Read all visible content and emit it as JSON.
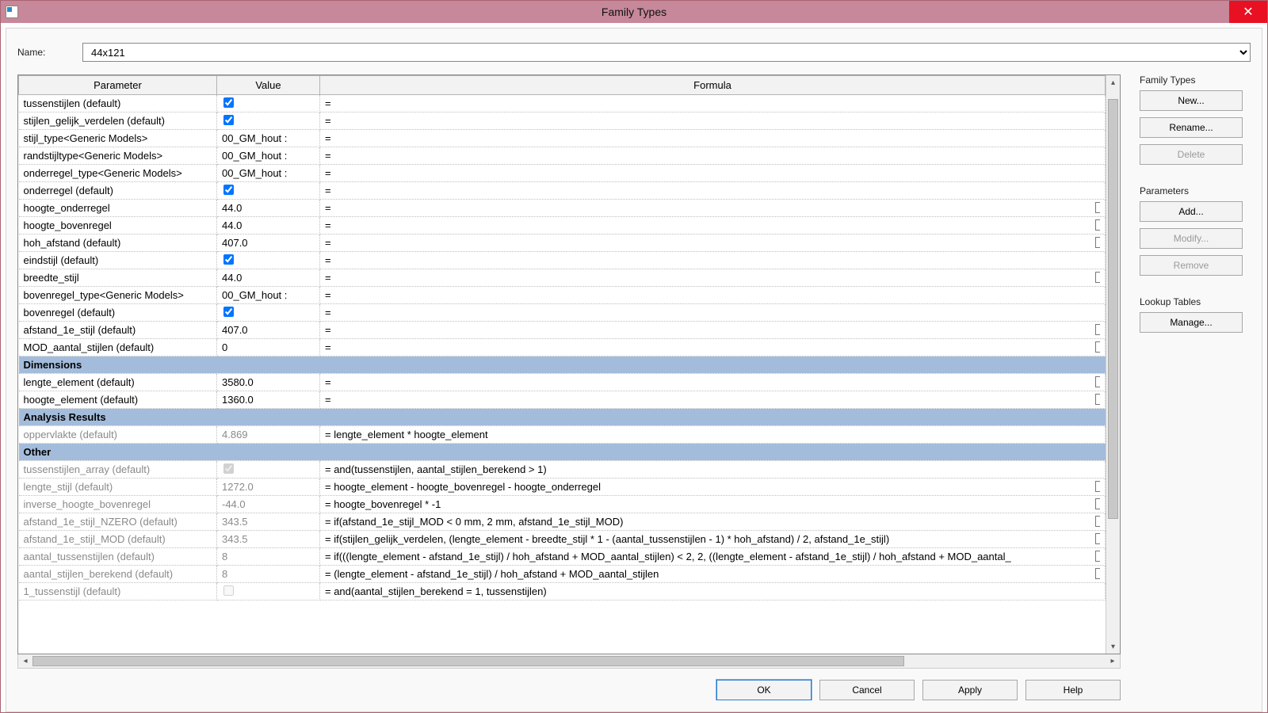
{
  "window": {
    "title": "Family Types",
    "close_glyph": "✕"
  },
  "name_label": "Name:",
  "name_value": "44x121",
  "columns": {
    "param": "Parameter",
    "value": "Value",
    "formula": "Formula"
  },
  "rows": [
    {
      "type": "row",
      "param": "tussenstijlen (default)",
      "value_kind": "check",
      "checked": true,
      "formula": "="
    },
    {
      "type": "row",
      "param": "stijlen_gelijk_verdelen (default)",
      "value_kind": "check",
      "checked": true,
      "formula": "="
    },
    {
      "type": "row",
      "param": "stijl_type<Generic Models>",
      "value_kind": "text",
      "value": "00_GM_hout :",
      "formula": "="
    },
    {
      "type": "row",
      "param": "randstijltype<Generic Models>",
      "value_kind": "text",
      "value": "00_GM_hout :",
      "formula": "="
    },
    {
      "type": "row",
      "param": "onderregel_type<Generic Models>",
      "value_kind": "text",
      "value": "00_GM_hout :",
      "formula": "="
    },
    {
      "type": "row",
      "param": "onderregel (default)",
      "value_kind": "check",
      "checked": true,
      "formula": "="
    },
    {
      "type": "row",
      "param": "hoogte_onderregel",
      "value_kind": "text",
      "value": "44.0",
      "formula": "=",
      "lock": true
    },
    {
      "type": "row",
      "param": "hoogte_bovenregel",
      "value_kind": "text",
      "value": "44.0",
      "formula": "=",
      "lock": true
    },
    {
      "type": "row",
      "param": "hoh_afstand (default)",
      "value_kind": "text",
      "value": "407.0",
      "formula": "=",
      "lock": true
    },
    {
      "type": "row",
      "param": "eindstijl (default)",
      "value_kind": "check",
      "checked": true,
      "formula": "="
    },
    {
      "type": "row",
      "param": "breedte_stijl",
      "value_kind": "text",
      "value": "44.0",
      "formula": "=",
      "lock": true
    },
    {
      "type": "row",
      "param": "bovenregel_type<Generic Models>",
      "value_kind": "text",
      "value": "00_GM_hout :",
      "formula": "="
    },
    {
      "type": "row",
      "param": "bovenregel (default)",
      "value_kind": "check",
      "checked": true,
      "formula": "="
    },
    {
      "type": "row",
      "param": "afstand_1e_stijl (default)",
      "value_kind": "text",
      "value": "407.0",
      "formula": "=",
      "lock": true
    },
    {
      "type": "row",
      "param": "MOD_aantal_stijlen (default)",
      "value_kind": "text",
      "value": "0",
      "formula": "=",
      "lock": true
    },
    {
      "type": "group",
      "param": "Dimensions"
    },
    {
      "type": "row",
      "param": "lengte_element (default)",
      "value_kind": "text",
      "value": "3580.0",
      "formula": "=",
      "lock": true
    },
    {
      "type": "row",
      "param": "hoogte_element (default)",
      "value_kind": "text",
      "value": "1360.0",
      "formula": "=",
      "lock": true
    },
    {
      "type": "group",
      "param": "Analysis Results"
    },
    {
      "type": "row",
      "readonly": true,
      "param": "oppervlakte (default)",
      "value_kind": "text",
      "value": "4.869",
      "formula": "= lengte_element * hoogte_element"
    },
    {
      "type": "group",
      "param": "Other"
    },
    {
      "type": "row",
      "readonly": true,
      "param": "tussenstijlen_array (default)",
      "value_kind": "check",
      "checked": true,
      "formula": "= and(tussenstijlen, aantal_stijlen_berekend > 1)"
    },
    {
      "type": "row",
      "readonly": true,
      "param": "lengte_stijl (default)",
      "value_kind": "text",
      "value": "1272.0",
      "formula": "= hoogte_element - hoogte_bovenregel - hoogte_onderregel",
      "lock": true
    },
    {
      "type": "row",
      "readonly": true,
      "param": "inverse_hoogte_bovenregel",
      "value_kind": "text",
      "value": "-44.0",
      "formula": "= hoogte_bovenregel * -1",
      "lock": true
    },
    {
      "type": "row",
      "readonly": true,
      "param": "afstand_1e_stijl_NZERO (default)",
      "value_kind": "text",
      "value": "343.5",
      "formula": "= if(afstand_1e_stijl_MOD < 0 mm, 2 mm, afstand_1e_stijl_MOD)",
      "lock": true
    },
    {
      "type": "row",
      "readonly": true,
      "param": "afstand_1e_stijl_MOD (default)",
      "value_kind": "text",
      "value": "343.5",
      "formula": "= if(stijlen_gelijk_verdelen, (lengte_element - breedte_stijl * 1 - (aantal_tussenstijlen - 1) * hoh_afstand) / 2, afstand_1e_stijl)",
      "lock": true
    },
    {
      "type": "row",
      "readonly": true,
      "param": "aantal_tussenstijlen (default)",
      "value_kind": "text",
      "value": "8",
      "formula": "= if(((lengte_element - afstand_1e_stijl) / hoh_afstand + MOD_aantal_stijlen) < 2, 2, ((lengte_element - afstand_1e_stijl) / hoh_afstand + MOD_aantal_",
      "lock": true
    },
    {
      "type": "row",
      "readonly": true,
      "param": "aantal_stijlen_berekend (default)",
      "value_kind": "text",
      "value": "8",
      "formula": "= (lengte_element - afstand_1e_stijl) / hoh_afstand + MOD_aantal_stijlen",
      "lock": true
    },
    {
      "type": "row",
      "readonly": true,
      "param": "1_tussenstijl (default)",
      "value_kind": "check",
      "checked": false,
      "formula": "= and(aantal_stijlen_berekend = 1, tussenstijlen)"
    }
  ],
  "sidebar": {
    "family_types_label": "Family Types",
    "new_btn": "New...",
    "rename_btn": "Rename...",
    "delete_btn": "Delete",
    "parameters_label": "Parameters",
    "add_btn": "Add...",
    "modify_btn": "Modify...",
    "remove_btn": "Remove",
    "lookup_label": "Lookup Tables",
    "manage_btn": "Manage..."
  },
  "footer": {
    "ok": "OK",
    "cancel": "Cancel",
    "apply": "Apply",
    "help": "Help"
  }
}
